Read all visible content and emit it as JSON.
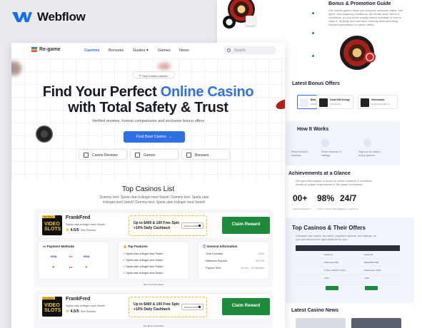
{
  "brand": {
    "name": "Webflow",
    "accent": "#146ef5"
  },
  "back": {
    "guide_title": "Bonus & Promotion Guide",
    "guide_text": "Get honest guides helps you compare welcome offers, free spins, and wagering conditions. We break down terms & conditions, so you know exactly what's available & how to claim it. Helping new members recently allow providing helpful explanations to casino offers.",
    "bonus_title": "Latest Bonus Offers",
    "bonus_cards": [
      {
        "name": "Blitz Casino",
        "sub": "Exclusive Bonus"
      },
      {
        "name": "Gold Gift Grenge",
        "sub": "Free Bonus"
      },
      {
        "name": "Videocasts",
        "sub": "Real Money Bonus"
      }
    ],
    "how_title": "How It Works",
    "how_steps": [
      "Read trusted reviews.",
      "Read reviews & ratings.",
      "Sign up to casino, enjoy games."
    ],
    "ach_title": "Achievements at a Glance",
    "ach_text": "We spent thousands of hours of online research & countless hands-on player experiences in the game of reviews!",
    "stats": [
      {
        "value": "00+",
        "label": "Casinos Reviewed"
      },
      {
        "value": "98%",
        "label": "Trust in Secure Platforms"
      },
      {
        "value": "24/7",
        "label": "Support • 24 Hours"
      }
    ],
    "offers_title": "Top Casinos & Their Offers",
    "offers_desc": "Compare top casino, bonuses, payment options, and ratings, so you can choose the right platform for you.",
    "table_rows": [
      [
        "Casino A",
        "Casino B"
      ],
      [
        "€ Bonuses 500",
        "€300-€500 300"
      ],
      [
        "€ Visa, PayPal, Crypto",
        "Mastercard, Skrill"
      ],
      [
        "4.5/5",
        "4.1/5"
      ]
    ],
    "news_title": "Latest Casino News"
  },
  "front": {
    "logo": "Re-game",
    "nav": [
      "Casinos",
      "Bonuses",
      "Guides",
      "Games",
      "News"
    ],
    "search_placeholder": "Search",
    "pill": "Only trusted casinos",
    "hero_line1_a": "Find Your Perfect",
    "hero_line1_b": "Online Casino",
    "hero_line2": "with Total Safety & Trust",
    "hero_sub": "Verified reviews, honest comparisons and exclusive bonus offers",
    "cta": "Find Best Casino",
    "tags": [
      "Casino Reviews",
      "Games",
      "Bonuses"
    ],
    "list_title": "Top Casinos List",
    "list_desc": "Dummy text: Spela utan krångel med Swish! Dummy text: Spela utan krångel med Swish! Dummy text: Spela utan krångel med Swish!",
    "cards": [
      {
        "badge": "Top Rated",
        "logo_text": "VIDEO SLOTS",
        "name": "FrankFred",
        "desc": "Spela utan krångel med Swish!",
        "rating": "4.5/5",
        "review": "See Review",
        "offer_line1": "Up to $400 & 100 Free Spin",
        "offer_line2": "+10% Daily Cashback",
        "code": "FanKomuch25",
        "claim": "Claim Reward",
        "payment_title": "Payment Methods",
        "payments": [
          "VISA",
          "●●",
          "VISA",
          "P",
          "●●",
          "P"
        ],
        "features_title": "Top Features",
        "features": [
          "Spela utan krångel med Swish!",
          "Spela utan krångel med Swish!",
          "Spela utan krångel med Swish!",
          "Spela utan krångel med Swish!"
        ],
        "general_title": "General Information",
        "general": [
          {
            "k": "Year Founded",
            "v": "2025"
          },
          {
            "k": "Minimum Deposit",
            "v": "$12.99"
          },
          {
            "k": "Payout Time",
            "v": "24 Hrs - 30 Minutes"
          }
        ],
        "more": "See Less Information"
      },
      {
        "badge": "Top Rated",
        "logo_text": "VIDEO SLOTS",
        "name": "FrankFred",
        "desc": "Spela utan krångel med Swish!",
        "rating": "4.5/5",
        "review": "See Review",
        "offer_line1": "Up to $400 & 100 Free Spin",
        "offer_line2": "+10% Daily Cashback",
        "code": "FanKomuch25",
        "claim": "Claim Reward",
        "more": "See More Information"
      }
    ]
  },
  "colors": {
    "blue": "#2f6fe4",
    "green": "#1e8a3c",
    "gold": "#f0b429",
    "dark": "#161a28"
  }
}
